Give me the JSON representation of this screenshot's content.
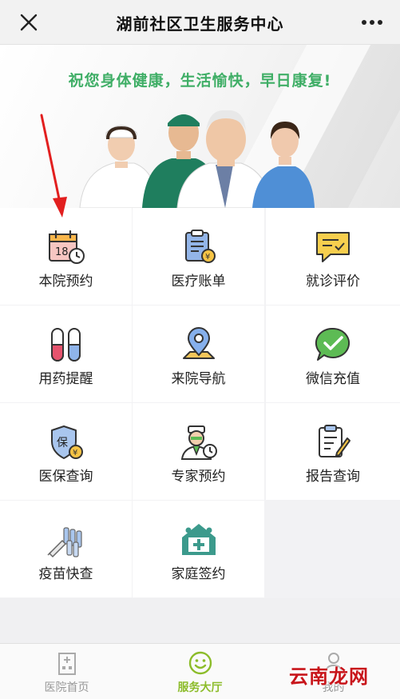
{
  "header": {
    "title": "湖前社区卫生服务中心",
    "close_icon": "close-icon",
    "more_icon": "more-dots-icon"
  },
  "banner": {
    "slogan": "祝您身体健康，生活愉快，早日康复!"
  },
  "grid": {
    "items": [
      {
        "label": "本院预约",
        "icon": "calendar-clock-icon"
      },
      {
        "label": "医疗账单",
        "icon": "bill-icon"
      },
      {
        "label": "就诊评价",
        "icon": "comment-check-icon"
      },
      {
        "label": "用药提醒",
        "icon": "pill-icon"
      },
      {
        "label": "来院导航",
        "icon": "map-pin-icon"
      },
      {
        "label": "微信充值",
        "icon": "wechat-icon"
      },
      {
        "label": "医保查询",
        "icon": "shield-insurance-icon"
      },
      {
        "label": "专家预约",
        "icon": "doctor-clock-icon"
      },
      {
        "label": "报告查询",
        "icon": "report-icon"
      },
      {
        "label": "疫苗快查",
        "icon": "vaccine-icon"
      },
      {
        "label": "家庭签约",
        "icon": "family-house-icon"
      }
    ],
    "calendar_day": "18",
    "insurance_char": "保"
  },
  "nav": {
    "tabs": [
      {
        "label": "医院首页",
        "icon": "hospital-icon",
        "active": false
      },
      {
        "label": "服务大厅",
        "icon": "smile-icon",
        "active": true
      },
      {
        "label": "我的",
        "icon": "person-icon",
        "active": false
      }
    ]
  },
  "watermark": "云南龙网",
  "colors": {
    "accent_green": "#3fae66",
    "active_tab": "#8cbc2a",
    "watermark_red": "#c8151b"
  }
}
